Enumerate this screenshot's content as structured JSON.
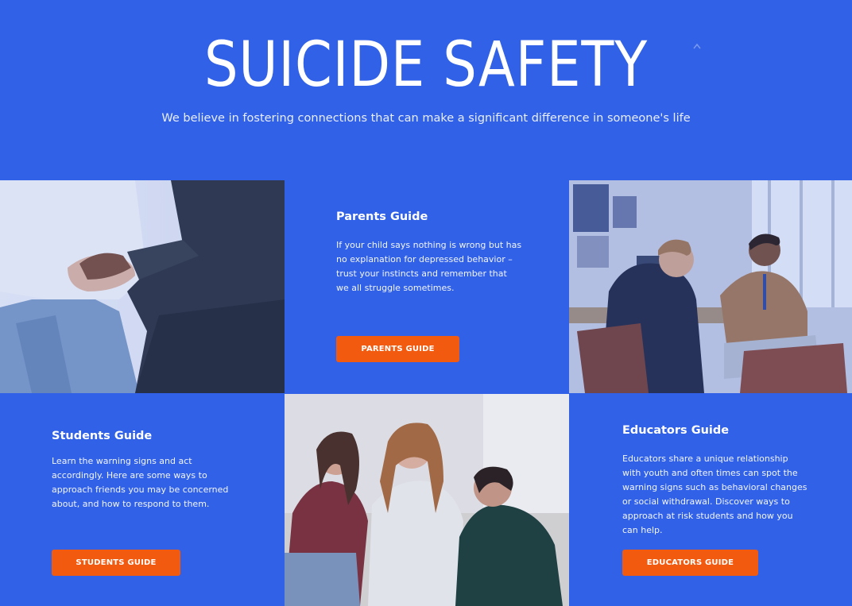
{
  "hero": {
    "title": "SUICIDE SAFETY",
    "subtitle": "We believe in fostering connections that can make a significant difference in someone's life"
  },
  "cards": {
    "parents": {
      "title": "Parents Guide",
      "body_lines": [
        "If your child says nothing is wrong but has",
        "no explanation for depressed behavior –",
        "trust your instincts and remember that",
        "we all struggle sometimes."
      ],
      "button": "PARENTS GUIDE"
    },
    "students": {
      "title": "Students Guide",
      "body_lines": [
        "Learn the warning signs and act",
        "accordingly. Here are some ways to",
        "approach friends you may be concerned",
        "about, and how to respond to them."
      ],
      "button": "STUDENTS GUIDE"
    },
    "educators": {
      "title": "Educators Guide",
      "body_lines": [
        "Educators share a unique relationship",
        "with youth and often times can spot the",
        "warning signs such as behavioral changes",
        "or social withdrawal. Discover ways to",
        "approach at risk students and how you",
        "can help."
      ],
      "button": "EDUCATORS GUIDE"
    }
  },
  "photos": {
    "holding_hands": "holding-hands-photo",
    "counseling": "counseling-session-photo",
    "friends": "friends-comforting-photo"
  },
  "colors": {
    "brand_blue": "#3161e6",
    "button_orange": "#f25a0f",
    "text_white": "#ffffff"
  }
}
